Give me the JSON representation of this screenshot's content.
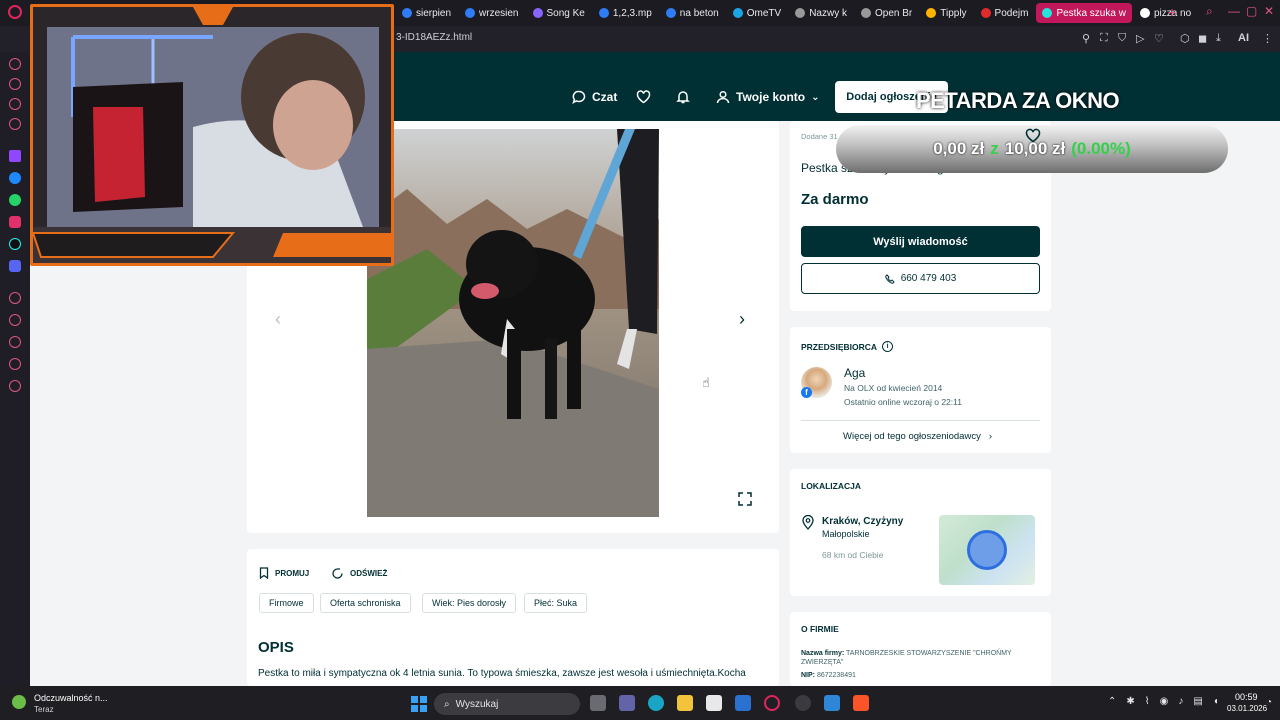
{
  "browser": {
    "tabs": [
      {
        "label": "sierpien",
        "color": "#2e7df6"
      },
      {
        "label": "wrzesien",
        "color": "#2e7df6"
      },
      {
        "label": "Song Ke",
        "color": "#8a64ff"
      },
      {
        "label": "1,2,3.mp",
        "color": "#2e7df6"
      },
      {
        "label": "na beton",
        "color": "#2e7df6"
      },
      {
        "label": "OmeTV",
        "color": "#1aa6e5"
      },
      {
        "label": "Nazwy k",
        "color": "#999"
      },
      {
        "label": "Open Br",
        "color": "#999"
      },
      {
        "label": "Tipply",
        "color": "#ffb400"
      },
      {
        "label": "Podejm",
        "color": "#e02b2b"
      },
      {
        "label": "Pestka szuka w",
        "color": "#23e5db"
      },
      {
        "label": "pizza no",
        "color": "#ffffff"
      }
    ],
    "url": "3-ID18AEZz.html",
    "ai_label": "AI"
  },
  "header": {
    "chat": "Czat",
    "account": "Twoje konto",
    "add_listing": "Dodaj ogłoszenie"
  },
  "listing": {
    "date": "Dodane 31 grudnia 2025",
    "title": "Pestka szuka wymarzonego domku",
    "price": "Za darmo",
    "send_message": "Wyślij wiadomość",
    "phone": "660 479 403"
  },
  "seller": {
    "type": "PRZEDSIĘBIORCA",
    "name": "Aga",
    "since": "Na OLX od kwiecień 2014",
    "online": "Ostatnio online wczoraj o 22:11",
    "more": "Więcej od tego ogłoszeniodawcy"
  },
  "location": {
    "heading": "LOKALIZACJA",
    "city": "Kraków, Czyżyny",
    "region": "Małopolskie",
    "distance": "68 km od Ciebie"
  },
  "firm": {
    "heading": "O FIRMIE",
    "name_label": "Nazwa firmy:",
    "name_value": "TARNOBRZESKIE STOWARZYSZENIE \"CHROŃMY ZWIERZĘTA\"",
    "nip_label": "NIP:",
    "nip_value": "8672238491"
  },
  "actions": {
    "promote": "PROMUJ",
    "refresh": "ODŚWIEŻ"
  },
  "tags": [
    "Firmowe",
    "Oferta schroniska",
    "Wiek: Pies dorosły",
    "Płeć: Suka"
  ],
  "description": {
    "heading": "OPIS",
    "text": "Pestka to miła i sympatyczna ok 4 letnia sunia. To typowa śmieszka, zawsze jest wesoła i uśmiechnięta.Kocha"
  },
  "overlay": {
    "title": "PETARDA ZA OKNO",
    "amount_current": "0,00 zł",
    "amount_sep": "z",
    "amount_goal": "10,00 zł",
    "percent": "(0.00%)",
    "goal_color": "#35d04a"
  },
  "taskbar": {
    "notification_title": "Odczuwalność n...",
    "notification_sub": "Teraz",
    "search": "Wyszukaj",
    "time": "00:59",
    "date": "03.01.2026"
  }
}
